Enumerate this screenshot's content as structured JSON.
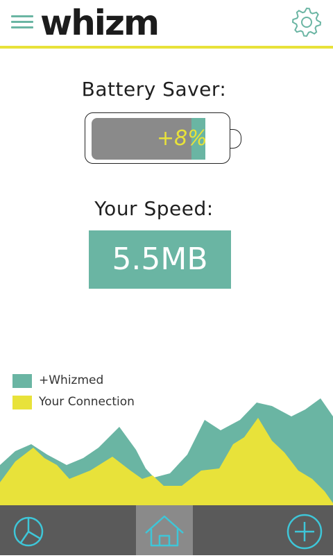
{
  "header": {
    "logo": "whizm",
    "menu_icon": "hamburger-menu-icon",
    "settings_icon": "gear-icon"
  },
  "battery": {
    "title": "Battery Saver:",
    "boost_label": "+8%",
    "base_level": 0.56,
    "boost_level": 0.08
  },
  "speed": {
    "title": "Your Speed:",
    "value": "5.5MB"
  },
  "legend": [
    {
      "label": "+Whizmed",
      "color": "#6ab5a3"
    },
    {
      "label": "Your Connection",
      "color": "#e8e23a"
    }
  ],
  "nav": {
    "left_icon": "pie-chart-icon",
    "center_icon": "home-icon",
    "right_icon": "plus-circle-icon"
  },
  "colors": {
    "accent_teal": "#6ab5a3",
    "accent_yellow": "#e8e23a",
    "nav_bg": "#5a5a5a",
    "nav_active": "#8a8a8a",
    "icon_blue": "#3ec6d8"
  }
}
